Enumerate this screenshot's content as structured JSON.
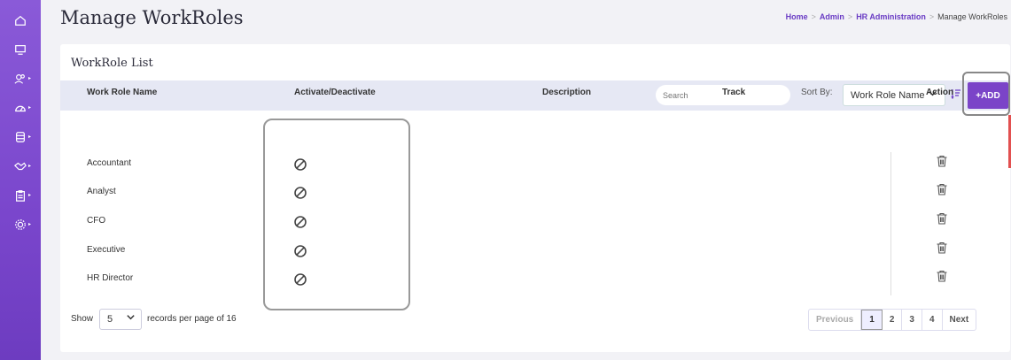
{
  "page": {
    "title": "Manage WorkRoles"
  },
  "breadcrumb": {
    "home": "Home",
    "admin": "Admin",
    "hr": "HR Administration",
    "current": "Manage WorkRoles",
    "sep": ">"
  },
  "card": {
    "title": "WorkRole List"
  },
  "toolbar": {
    "search_placeholder": "Search",
    "sort_label": "Sort By:",
    "sort_value": "Work Role Name",
    "add_label": "+ADD"
  },
  "table": {
    "headers": [
      "Work Role Name",
      "Activate/Deactivate",
      "Description",
      "Track",
      "Action"
    ],
    "rows": [
      {
        "name": "Accountant"
      },
      {
        "name": "Analyst"
      },
      {
        "name": "CFO"
      },
      {
        "name": "Executive"
      },
      {
        "name": "HR Director"
      }
    ]
  },
  "footer": {
    "show_label": "Show",
    "page_size": "5",
    "records_text": "records per page of 16"
  },
  "pager": {
    "prev": "Previous",
    "pages": [
      "1",
      "2",
      "3",
      "4"
    ],
    "next": "Next",
    "current": "1"
  },
  "icons": {
    "row_status": "ban-icon",
    "row_action": "trash-icon"
  },
  "colors": {
    "accent": "#7b44c8",
    "sidebar": "#7a46cc"
  }
}
